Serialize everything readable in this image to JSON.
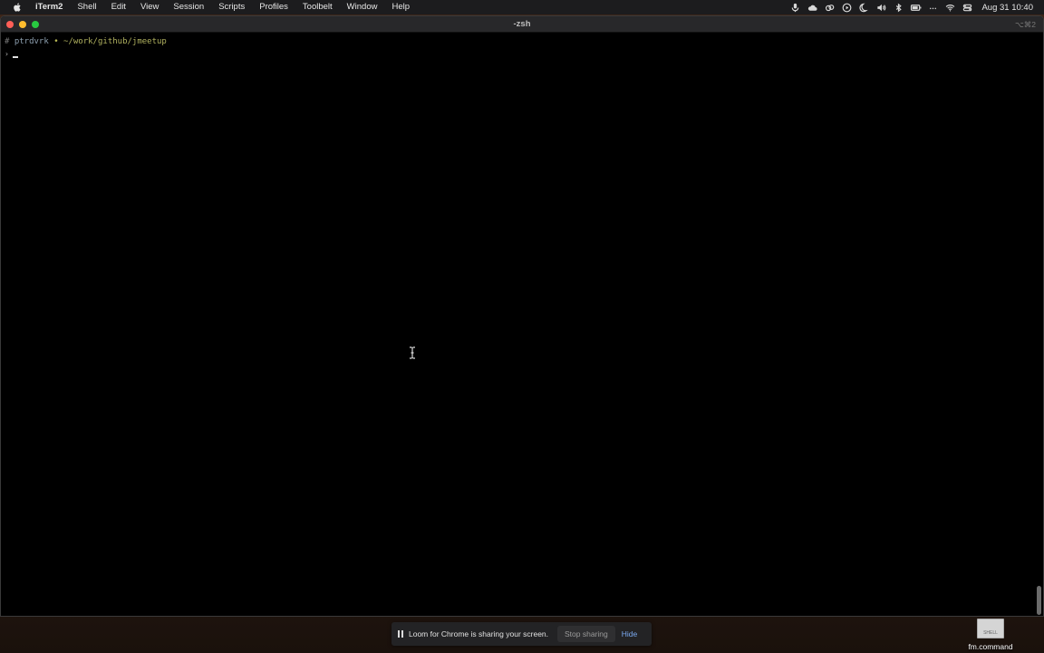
{
  "menubar": {
    "app_name": "iTerm2",
    "menus": [
      "Shell",
      "Edit",
      "View",
      "Session",
      "Scripts",
      "Profiles",
      "Toolbelt",
      "Window",
      "Help"
    ],
    "clock": "Aug 31  10:40",
    "status_icons": [
      "microphone-icon",
      "cloud-icon",
      "creative-cloud-icon",
      "play-icon",
      "moon-icon",
      "volume-icon",
      "bluetooth-icon",
      "battery-icon",
      "dots-icon",
      "wifi-icon",
      "control-center-icon"
    ]
  },
  "window": {
    "title": "-zsh",
    "shortcut": "⌥⌘2"
  },
  "terminal": {
    "prompt_hash": "#",
    "user": "ptrdvrk",
    "separator": "•",
    "path": "~/work/github/jmeetup",
    "prompt_symbol": "›"
  },
  "loom": {
    "message": "Loom for Chrome is sharing your screen.",
    "stop_label": "Stop sharing",
    "hide_label": "Hide"
  },
  "desktop": {
    "file_name": "fm.command",
    "thumb_label": "SHELL"
  },
  "colors": {
    "terminal_bg": "#000000",
    "path": "#b0b15f",
    "link": "#7aa9f0"
  }
}
